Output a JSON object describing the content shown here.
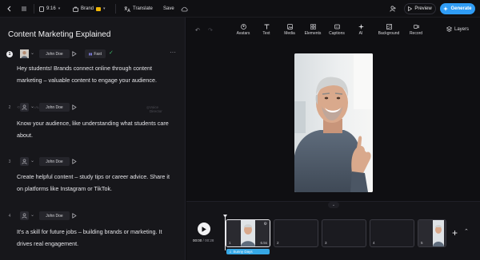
{
  "topbar": {
    "time_label": "9:16",
    "brand_label": "Brand",
    "translate_label": "Translate",
    "save_label": "Save",
    "preview_label": "Preview",
    "generate_label": "Generate"
  },
  "script": {
    "title": "Content Marketing Explained",
    "scenes": [
      {
        "number": "1",
        "voice": "John Doe",
        "speed": "Fast",
        "text": "Hey students! Brands connect online through content marketing – valuable content to engage your audience.",
        "actions": [
          "Voice",
          "Audio",
          "Pause",
          "Voice Director"
        ]
      },
      {
        "number": "2",
        "voice": "John Doe",
        "text": "Know your audience, like understanding what students care about."
      },
      {
        "number": "3",
        "voice": "John Doe",
        "text": "Create helpful content – study tips or career advice. Share it on platforms like Instagram or TikTok."
      },
      {
        "number": "4",
        "voice": "John Doe",
        "text": "It's a skill for future jobs – building brands or marketing. It drives real engagement."
      }
    ]
  },
  "toolbar": {
    "tools": [
      "Avatars",
      "Text",
      "Media",
      "Elements",
      "Captions",
      "AI",
      "Background",
      "Record"
    ],
    "layers_label": "Layers"
  },
  "timeline": {
    "current_time": "00:00",
    "total_time": "00:28",
    "clips": [
      {
        "number": "1",
        "duration": "6.5s"
      },
      {
        "number": "2"
      },
      {
        "number": "3"
      },
      {
        "number": "4"
      },
      {
        "number": "5"
      }
    ],
    "music_label": "Sunny Days"
  },
  "colors": {
    "accent": "#2f9cf5",
    "music_track": "#36a8e6",
    "success": "#3dbb6b",
    "brand_badge": "#f2b705"
  }
}
